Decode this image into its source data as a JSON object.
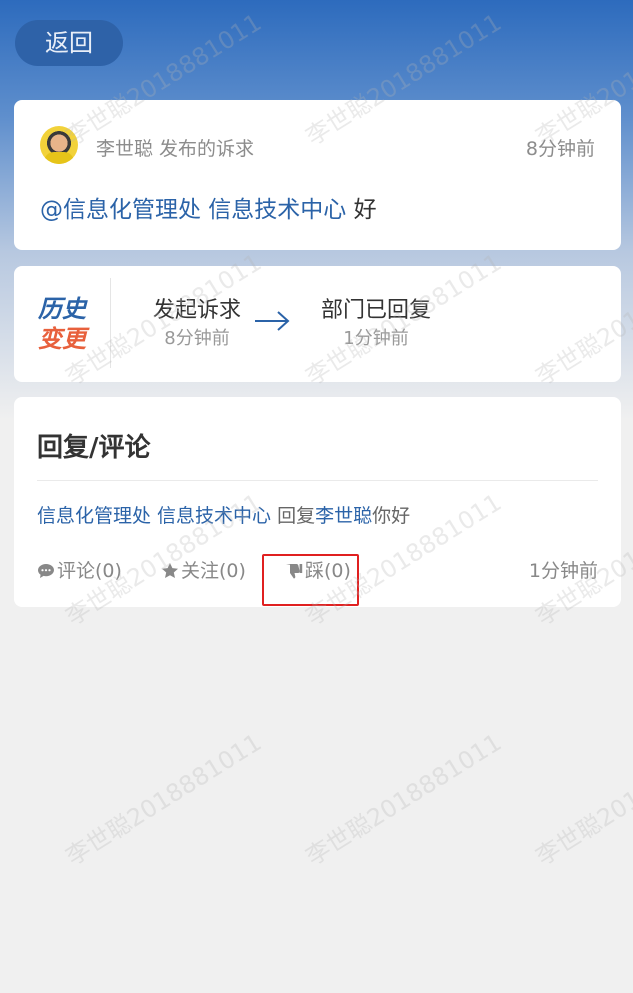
{
  "header": {
    "back_label": "返回"
  },
  "post": {
    "author_line": "李世聪 发布的诉求",
    "time": "8分钟前",
    "mention": "@信息化管理处 信息技术中心",
    "text": "好"
  },
  "history": {
    "logo_line1": "历史",
    "logo_line2": "变更",
    "steps": [
      {
        "title": "发起诉求",
        "time": "8分钟前"
      },
      {
        "title": "部门已回复",
        "time": "1分钟前"
      }
    ]
  },
  "reply": {
    "section_title": "回复/评论",
    "author": "信息化管理处 信息技术中心",
    "verb": "回复",
    "target": "李世聪",
    "text": "你好",
    "actions": {
      "comment": "评论(0)",
      "follow": "关注(0)",
      "dislike": "踩(0)",
      "time": "1分钟前"
    }
  },
  "watermark": {
    "text": "李世聪2018881011"
  },
  "colors": {
    "accent": "#2b63a8",
    "highlight": "#e02020"
  }
}
